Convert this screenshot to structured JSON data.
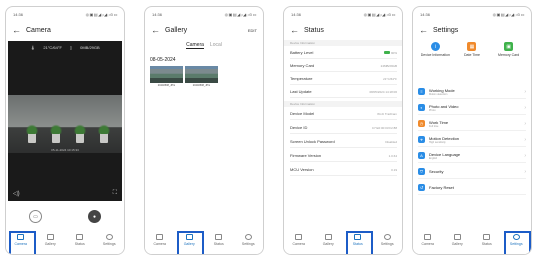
{
  "colors": {
    "accent": "#1e73be",
    "highlight_box": "#1c5cc7",
    "battery_green": "#3fb24b",
    "info_blue": "#2a8de6",
    "orange": "#f08a2c",
    "green": "#3fb24b"
  },
  "status_bar": {
    "time": "14:36",
    "icons": "◎▣▤◢ᵢₗ◢ᵢₗ⊙▭"
  },
  "nav_items": [
    "Camera",
    "Gallery",
    "Status",
    "Settings"
  ],
  "camera": {
    "title": "Camera",
    "temperature": "21°C/64°F",
    "storage": "0MB/29GB",
    "timestamp": "05-11-2024 10:15:33",
    "left_icon": "speaker-icon",
    "right_icon": "fullscreen-icon"
  },
  "gallery": {
    "title": "Gallery",
    "edit_label": "EDIT",
    "tabs": [
      "Camera",
      "Local"
    ],
    "date": "08-05-2024",
    "thumbnails": [
      {
        "caption": "20240508_JPG"
      },
      {
        "caption": "20240508_JPG"
      }
    ]
  },
  "status": {
    "title": "Status",
    "section_device_info": "Device Information",
    "section_more": "Device Information",
    "rows_top": [
      {
        "key": "Battery Level",
        "value": "90%"
      },
      {
        "key": "Memory Card",
        "value": "24MB/29GB"
      },
      {
        "key": "Temperature",
        "value": "21°C/64°F"
      },
      {
        "key": "Last Update",
        "value": "08/05/2024 14:18:06"
      }
    ],
    "rows_bottom": [
      {
        "key": "Device Model",
        "value": "Wi-Fi TrailCam"
      },
      {
        "key": "Device ID",
        "value": "C7:E0:00:03:F2:88"
      },
      {
        "key": "Screen Unlock Password",
        "value": "Disabled"
      },
      {
        "key": "Firmware Version",
        "value": "1.0.64"
      },
      {
        "key": "MCU Version",
        "value": "0.19"
      }
    ]
  },
  "settings": {
    "title": "Settings",
    "quick": [
      {
        "label": "Device Information",
        "icon": "info-icon"
      },
      {
        "label": "Date Time",
        "icon": "calendar-icon"
      },
      {
        "label": "Memory Card",
        "icon": "memory-card-icon"
      }
    ],
    "rows": [
      {
        "title": "Working Mode",
        "sub": "Motion detection"
      },
      {
        "title": "Photo and Video",
        "sub": "Photo"
      },
      {
        "title": "Work Time",
        "sub": "Full time"
      },
      {
        "title": "Motion Detection",
        "sub": "High sensitivity"
      },
      {
        "title": "Device Language",
        "sub": "English"
      },
      {
        "title": "Security",
        "sub": ""
      },
      {
        "title": "Factory Reset",
        "sub": ""
      }
    ]
  }
}
